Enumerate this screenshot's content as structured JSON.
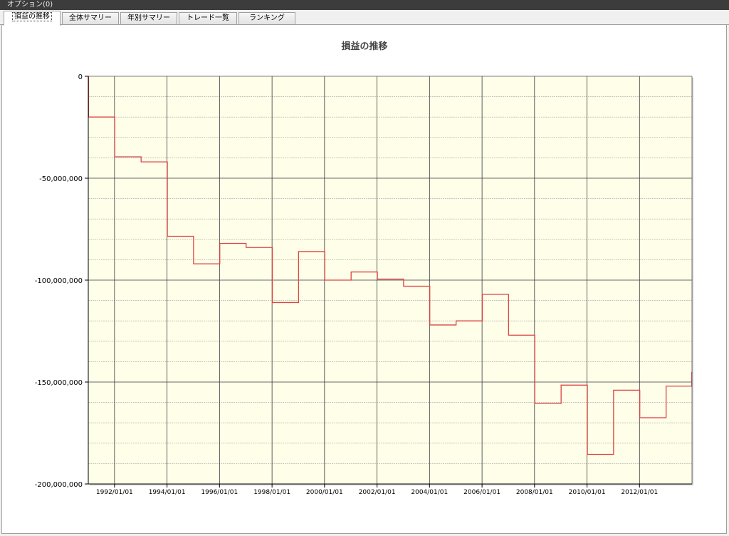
{
  "window": {
    "title": "オプション(0)"
  },
  "tabs": [
    {
      "label": "損益の推移",
      "active": true
    },
    {
      "label": "全体サマリー",
      "active": false
    },
    {
      "label": "年別サマリー",
      "active": false
    },
    {
      "label": "トレード一覧",
      "active": false
    },
    {
      "label": "ランキング",
      "active": false
    }
  ],
  "colors": {
    "plot_background": "#fefee9",
    "series_line": "#dd4444",
    "major_grid": "#3a3a3a",
    "minor_grid": "#a8a8a8"
  },
  "chart_data": {
    "type": "line",
    "step": true,
    "title": "損益の推移",
    "xlabel": "",
    "ylabel": "",
    "xlim": [
      "1991/01/01",
      "2013/12/31"
    ],
    "ylim": [
      -200000000,
      0
    ],
    "y_ticks": [
      0,
      -50000000,
      -100000000,
      -150000000,
      -200000000
    ],
    "y_tick_labels": [
      "0",
      "-50,000,000",
      "-100,000,000",
      "-150,000,000",
      "-200,000,000"
    ],
    "x_tick_labels": [
      "1992/01/01",
      "1994/01/01",
      "1996/01/01",
      "1998/01/01",
      "2000/01/01",
      "2002/01/01",
      "2004/01/01",
      "2006/01/01",
      "2008/01/01",
      "2010/01/01",
      "2012/01/01"
    ],
    "grid": true,
    "legend": "none",
    "series": [
      {
        "x": [
          "1991/01/01",
          "1991/01/05",
          "1992/01/05",
          "1993/01/05",
          "1994/01/05",
          "1995/01/05",
          "1996/01/05",
          "1997/01/05",
          "1998/01/05",
          "1999/01/05",
          "2000/01/05",
          "2001/01/05",
          "2002/01/05",
          "2003/01/05",
          "2004/01/05",
          "2005/01/05",
          "2006/01/05",
          "2007/01/05",
          "2008/01/05",
          "2009/01/05",
          "2010/01/05",
          "2011/01/05",
          "2012/01/05",
          "2013/01/05",
          "2013/12/28"
        ],
        "values": [
          0,
          -20000000,
          -39500000,
          -42000000,
          -78500000,
          -92000000,
          -82000000,
          -84000000,
          -111000000,
          -86000000,
          -100000000,
          -96000000,
          -99500000,
          -103000000,
          -122000000,
          -120000000,
          -107000000,
          -127000000,
          -160500000,
          -151500000,
          -185500000,
          -154000000,
          -167500000,
          -152000000,
          -145000000
        ]
      }
    ]
  }
}
